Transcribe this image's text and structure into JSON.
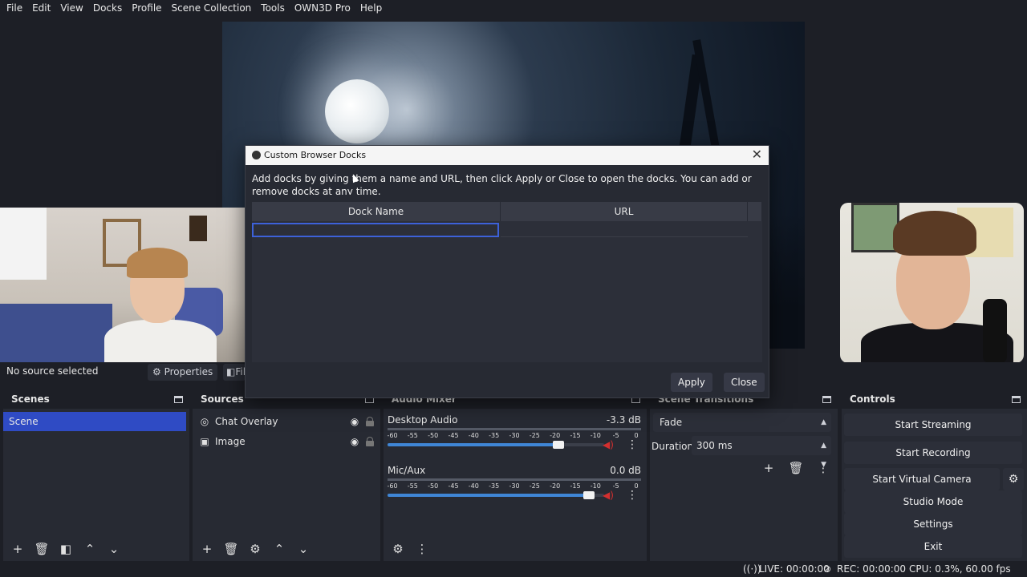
{
  "menu": [
    "File",
    "Edit",
    "View",
    "Docks",
    "Profile",
    "Scene Collection",
    "Tools",
    "OWN3D Pro",
    "Help"
  ],
  "properties_bar": {
    "no_source": "No source selected",
    "properties_label": "Properties",
    "filters_label": "Filters"
  },
  "dialog": {
    "title": "Custom Browser Docks",
    "description": "Add docks by giving them a name and URL, then click Apply or Close to open the docks. You can add or remove docks at any time.",
    "col_name": "Dock Name",
    "col_url": "URL",
    "apply_label": "Apply",
    "close_label": "Close"
  },
  "scenes": {
    "title": "Scenes",
    "items": [
      "Scene"
    ]
  },
  "sources": {
    "title": "Sources",
    "items": [
      {
        "label": "Chat Overlay",
        "icon": "globe-icon"
      },
      {
        "label": "Image",
        "icon": "image-icon"
      }
    ]
  },
  "mixer": {
    "title": "Audio Mixer",
    "ticks": [
      "-60",
      "-55",
      "-50",
      "-45",
      "-40",
      "-35",
      "-30",
      "-25",
      "-20",
      "-15",
      "-10",
      "-5",
      "0"
    ],
    "channels": [
      {
        "name": "Desktop Audio",
        "db": "-3.3 dB",
        "volume": 0.79
      },
      {
        "name": "Mic/Aux",
        "db": "0.0 dB",
        "volume": 0.93
      }
    ]
  },
  "transitions": {
    "title": "Scene Transitions",
    "selected": "Fade",
    "duration_label": "Duration",
    "duration_value": "300 ms"
  },
  "controls": {
    "title": "Controls",
    "start_streaming": "Start Streaming",
    "start_recording": "Start Recording",
    "start_virtual_camera": "Start Virtual Camera",
    "studio_mode": "Studio Mode",
    "settings": "Settings",
    "exit": "Exit"
  },
  "status": {
    "live": "LIVE: 00:00:00",
    "rec": "REC: 00:00:00",
    "cpu": "CPU: 0.3%, 60.00 fps"
  },
  "colors": {
    "accent": "#2f4bc4",
    "background": "#1d1f26",
    "panel": "#272a33",
    "mute_red": "#d32f2f"
  }
}
